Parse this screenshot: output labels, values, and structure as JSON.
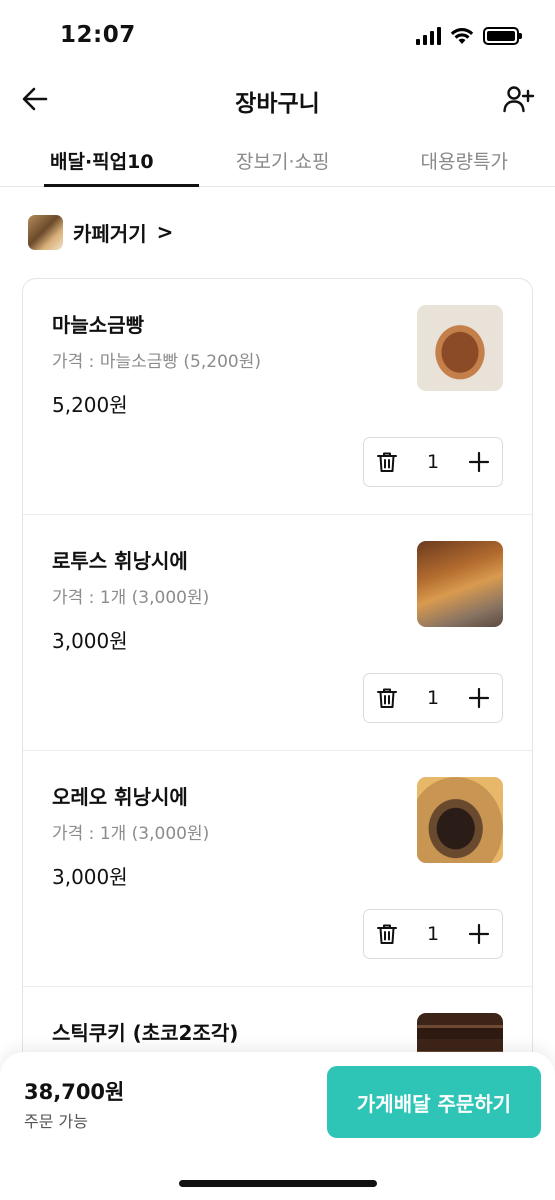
{
  "status_bar": {
    "time": "12:07"
  },
  "header": {
    "title": "장바구니",
    "back_icon": "arrow-left-icon",
    "invite_icon": "person-add-icon"
  },
  "tabs": [
    {
      "label": "배달·픽업10",
      "active": true
    },
    {
      "label": "장보기·쇼핑",
      "active": false
    },
    {
      "label": "대용량특가",
      "active": false
    }
  ],
  "store": {
    "name": "카페거기",
    "chevron": ">"
  },
  "cart_items": [
    {
      "name": "마늘소금빵",
      "option": "가격 : 마늘소금빵 (5,200원)",
      "price": "5,200원",
      "quantity": "1"
    },
    {
      "name": "로투스 휘낭시에",
      "option": "가격 : 1개 (3,000원)",
      "price": "3,000원",
      "quantity": "1"
    },
    {
      "name": "오레오 휘낭시에",
      "option": "가격 : 1개 (3,000원)",
      "price": "3,000원",
      "quantity": "1"
    },
    {
      "name": "스틱쿠키 (초코2조각)",
      "option": "",
      "price": "",
      "quantity": ""
    }
  ],
  "footer": {
    "total": "38,700원",
    "status": "주문 가능",
    "order_button": "가게배달 주문하기"
  },
  "colors": {
    "accent": "#2ec4b6",
    "text": "#111111",
    "muted": "#8c8c8c"
  }
}
